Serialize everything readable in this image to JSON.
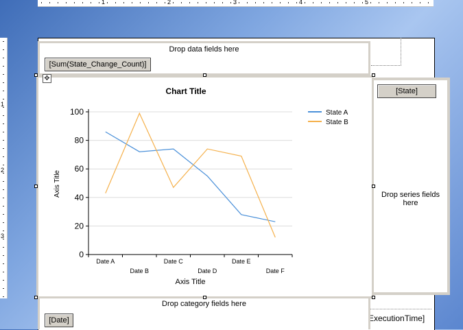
{
  "ruler": {
    "top_numbers": [
      "1",
      "2",
      "3",
      "4",
      "5"
    ],
    "left_numbers": [
      "1",
      "2",
      "3"
    ]
  },
  "data_zone": {
    "label": "Drop data fields here",
    "field": "[Sum(State_Change_Count)]"
  },
  "series_zone": {
    "label": "Drop series fields here",
    "field": "[State]"
  },
  "category_zone": {
    "label": "Drop category fields here",
    "field": "[Date]"
  },
  "exec_field": "ExecutionTime]",
  "icons": {
    "move": "move-arrows-icon"
  },
  "colors": {
    "state_a": "#4a90d9",
    "state_b": "#f5b04a",
    "gridline": "#dcdcdc",
    "zone_border": "#d4d0c8"
  },
  "chart_data": {
    "type": "line",
    "title": "Chart Title",
    "xlabel": "Axis Title",
    "ylabel": "Axis Title",
    "categories": [
      "Date A",
      "Date B",
      "Date C",
      "Date D",
      "Date E",
      "Date F"
    ],
    "ylim": [
      0,
      100
    ],
    "yticks": [
      0,
      20,
      40,
      60,
      80,
      100
    ],
    "grid": true,
    "legend": "top-right",
    "series": [
      {
        "name": "State A",
        "values": [
          86,
          72,
          74,
          55,
          28,
          23
        ]
      },
      {
        "name": "State B",
        "values": [
          43,
          99,
          47,
          74,
          69,
          12
        ]
      }
    ]
  }
}
